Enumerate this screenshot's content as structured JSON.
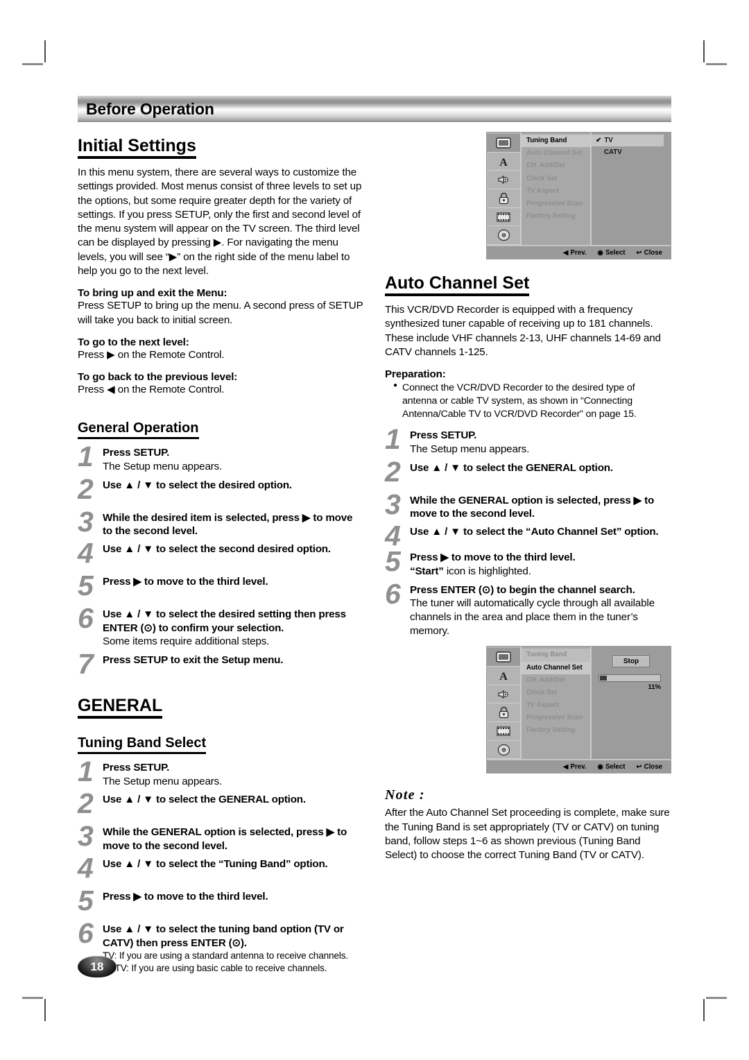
{
  "chapter": {
    "title": "Before Operation"
  },
  "page": {
    "number": "18"
  },
  "left": {
    "section_title": "Initial Settings",
    "intro": "In this menu system, there are several ways to customize the settings provided. Most menus consist of three levels to set up the options, but some require greater depth for the variety of settings. If you press SETUP, only the first and second level of the menu system will appear on the TV screen. The third level can be displayed by pressing ▶. For navigating the menu levels, you will see “▶” on the right side of the menu label to help you go to the next level.",
    "blocks": [
      {
        "heading": "To bring up and exit the Menu:",
        "text": "Press SETUP to bring up the menu. A second press of SETUP will take you back to initial screen."
      },
      {
        "heading": "To go to the next level:",
        "text": "Press ▶ on the Remote Control."
      },
      {
        "heading": "To go back to the previous level:",
        "text": "Press ◀ on the Remote Control."
      }
    ],
    "general_operation_title": "General Operation",
    "general_operation_steps": [
      {
        "num": "1",
        "bold": "Press SETUP.",
        "sub": "The Setup menu appears."
      },
      {
        "num": "2",
        "bold": "Use ▲ / ▼ to select the desired option.",
        "sub": ""
      },
      {
        "num": "3",
        "bold": "While the desired item is selected, press ▶ to move to the second level.",
        "sub": ""
      },
      {
        "num": "4",
        "bold": "Use ▲ / ▼ to select the second desired option.",
        "sub": ""
      },
      {
        "num": "5",
        "bold": "Press ▶ to move to the third level.",
        "sub": ""
      },
      {
        "num": "6",
        "bold": "Use ▲ / ▼ to select the desired setting then press ENTER (⊙) to confirm your selection.",
        "sub": "Some items require additional steps."
      },
      {
        "num": "7",
        "bold": "Press SETUP to exit the Setup menu.",
        "sub": ""
      }
    ],
    "general_title": "GENERAL",
    "tuning_band_title": "Tuning Band Select",
    "tuning_band_steps": [
      {
        "num": "1",
        "bold": "Press SETUP.",
        "sub": "The Setup menu appears."
      },
      {
        "num": "2",
        "bold": "Use ▲ / ▼ to select the GENERAL option.",
        "sub": ""
      },
      {
        "num": "3",
        "bold": "While the GENERAL option is selected, press ▶ to move to the second level.",
        "sub": ""
      },
      {
        "num": "4",
        "bold": "Use ▲ / ▼ to select the “Tuning Band” option.",
        "sub": ""
      },
      {
        "num": "5",
        "bold": "Press ▶ to move to the third level.",
        "sub": ""
      },
      {
        "num": "6",
        "bold": "Use ▲ / ▼ to select the tuning band option (TV or CATV) then press ENTER (⊙).",
        "sub": "TV: If you are using a standard antenna to receive channels.",
        "sub2": "CATV: If you are using basic cable to receive channels."
      }
    ]
  },
  "right": {
    "auto_channel_title": "Auto Channel Set",
    "auto_channel_intro": "This VCR/DVD Recorder is equipped with a frequency synthesized tuner capable of receiving up to 181 channels. These include VHF channels 2-13, UHF channels 14-69 and CATV channels 1-125.",
    "preparation_heading": "Preparation:",
    "preparation_bullets": [
      "Connect the VCR/DVD Recorder to the desired type of antenna or cable TV system, as shown in “Connecting Antenna/Cable TV to VCR/DVD Recorder” on page 15."
    ],
    "auto_channel_steps": [
      {
        "num": "1",
        "bold": "Press SETUP.",
        "sub": "The Setup menu appears."
      },
      {
        "num": "2",
        "bold": "Use ▲ / ▼ to select the GENERAL option.",
        "sub": ""
      },
      {
        "num": "3",
        "bold": "While the GENERAL option is selected, press ▶ to move to the second level.",
        "sub": ""
      },
      {
        "num": "4",
        "bold": "Use ▲ / ▼ to select the “Auto Channel Set” option.",
        "sub": ""
      },
      {
        "num": "5",
        "bold": "Press ▶ to move to the third level.",
        "sub_bold": "“Start”",
        "sub": " icon is highlighted."
      },
      {
        "num": "6",
        "bold": "Press ENTER (⊙) to begin the channel search.",
        "sub": "The tuner will automatically cycle through all available channels in the area and place them in the tuner’s memory."
      }
    ],
    "note_title": "Note :",
    "note_text": "After the Auto Channel Set proceeding is complete, make sure the Tuning Band is set appropriately (TV or CATV) on tuning band, follow steps 1~6 as shown previous (Tuning Band Select) to choose the correct Tuning Band (TV or CATV)."
  },
  "osd": {
    "icons": [
      "tv-monitor-icon",
      "language-a-icon",
      "audio-speaker-icon",
      "parental-lock-icon",
      "film-strip-icon",
      "disc-icon"
    ],
    "menu_items": [
      "Tuning Band",
      "Auto Channel Set",
      "CH. Add/Del",
      "Clock Set",
      "TV Aspect",
      "Progressive Scan",
      "Factory Setting"
    ],
    "status": {
      "prev": "Prev.",
      "select": "Select",
      "close": "Close"
    },
    "screen1": {
      "selected_item": "Tuning Band",
      "options": [
        "TV",
        "CATV"
      ],
      "checked_option": "TV"
    },
    "screen2": {
      "selected_item": "Auto Channel Set",
      "stop_label": "Stop",
      "progress_percent": "11%",
      "progress_value": 11
    }
  }
}
